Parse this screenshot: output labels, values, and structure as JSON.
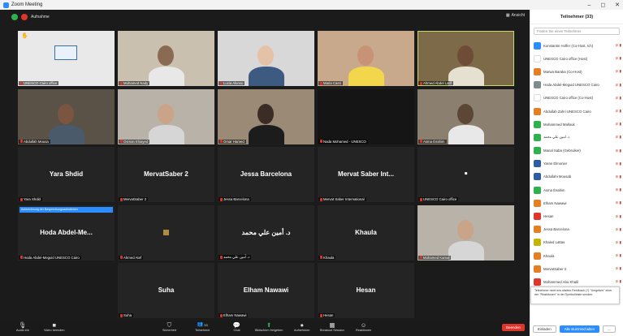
{
  "window": {
    "title": "Zoom Meeting",
    "minimize": "–",
    "maximize": "◻",
    "close": "✕"
  },
  "top": {
    "status": "Aufnahme",
    "view": "Ansicht"
  },
  "tiles": [
    {
      "label": "UNESCO Cairo office",
      "type": "video"
    },
    {
      "label": "Mohamed Nady",
      "type": "video"
    },
    {
      "label": "Lucia Alonso",
      "type": "video"
    },
    {
      "label": "Maria Casti",
      "type": "video"
    },
    {
      "label": "Ahmed Abdel Latif",
      "type": "video"
    },
    {
      "label": "Abdullah Mousa",
      "type": "video"
    },
    {
      "label": "Osman Elsayed",
      "type": "video"
    },
    {
      "label": "Omar Hamed",
      "type": "video"
    },
    {
      "label": "Nada Mohamed - UNESCO",
      "type": "video"
    },
    {
      "label": "Asma Ibrahim",
      "type": "video"
    },
    {
      "name": "Yara Shdid",
      "label": "Yara Shdid",
      "type": "name"
    },
    {
      "name": "MervatSaber 2",
      "label": "MervatSaber 2",
      "type": "name"
    },
    {
      "name": "Jessa Barcelona",
      "label": "Jessa Barcelona",
      "type": "name"
    },
    {
      "name": "Mervat Saber Int...",
      "label": "Mervat Saber International",
      "type": "name"
    },
    {
      "name": "■",
      "label": "UNESCO Cairo office",
      "type": "name"
    },
    {
      "name": "Hoda Abdel-Me...",
      "label": "Hoda Abdel-Meguid UNESCO Cairo",
      "type": "name"
    },
    {
      "name": "",
      "label": "Ahmed Atef",
      "type": "name"
    },
    {
      "name": "د. أمين علي محمد",
      "label": "د. أمين علي محمد",
      "type": "name"
    },
    {
      "name": "Khaula",
      "label": "Khaula",
      "type": "name"
    },
    {
      "label": "Mohamed Kamal",
      "type": "video"
    },
    {
      "name": "Suha",
      "label": "Suha",
      "type": "name"
    },
    {
      "name": "Elham Nawawi",
      "label": "Elham Nawawi",
      "type": "name"
    },
    {
      "name": "Hesan",
      "label": "Hesan",
      "type": "name"
    }
  ],
  "banner": "Aufzeichnung der Besprechungsaufnahmen",
  "panel": {
    "title": "Teilnehmer (33)",
    "search_placeholder": "Finden Sie einen Teilnehmer",
    "participants": [
      {
        "name": "Konstantin Hoffer (Co-Host, Ich)",
        "color": "#2d8cff"
      },
      {
        "name": "UNESCO Cairo office (Host)",
        "color": "#ffffff"
      },
      {
        "name": "Marwa Baraka (Co-Host)",
        "color": "#e67e22"
      },
      {
        "name": "Hoda Abdel-Meguid UNESCO Cairo",
        "color": "#7f8c8d"
      },
      {
        "name": "UNESCO Cairo office (Co-Host)",
        "color": "#ffffff"
      },
      {
        "name": "Abdullah Zahri UNESCO Cairo",
        "color": "#e67e22"
      },
      {
        "name": "Mohammed Mallouk",
        "color": "#2fb24c"
      },
      {
        "name": "د. أمين علي محمد",
        "color": "#2fb24c"
      },
      {
        "name": "Manal Saba (Gebruiker)",
        "color": "#2fb24c"
      },
      {
        "name": "Yaran Elmonier",
        "color": "#2d5fa0"
      },
      {
        "name": "Abdullahi Mousab",
        "color": "#2d5fa0"
      },
      {
        "name": "Asma Ibrahim",
        "color": "#2fb24c"
      },
      {
        "name": "Elham Nawawi",
        "color": "#e67e22"
      },
      {
        "name": "Hesan",
        "color": "#e0352b"
      },
      {
        "name": "Jessa Barcelona",
        "color": "#e67e22"
      },
      {
        "name": "Khaled Lattas",
        "color": "#c8b400"
      },
      {
        "name": "Khaula",
        "color": "#e67e22"
      },
      {
        "name": "MervatSaber 2",
        "color": "#e67e22"
      },
      {
        "name": "Mohammed Abu Khalil",
        "color": "#e0352b"
      }
    ],
    "tooltip": "Teilnehmer nicht neu starten Feedback (?) \"Umgeben\" einer der \"Reaktionen\" in der Symbolleiste senden.",
    "invite": "Einladen",
    "mute_all": "Alle stummschalten",
    "more": "..."
  },
  "toolbar": {
    "audio": "Audio ein",
    "video": "Video beenden",
    "security": "Sicherheit",
    "participants": "Teilnehmer",
    "participants_count": "33",
    "chat": "Chat",
    "share": "Bildschirm freigeben",
    "record": "Aufnehmen",
    "breakout": "Breakout Session",
    "reactions": "Reaktionen",
    "end": "Beenden"
  }
}
